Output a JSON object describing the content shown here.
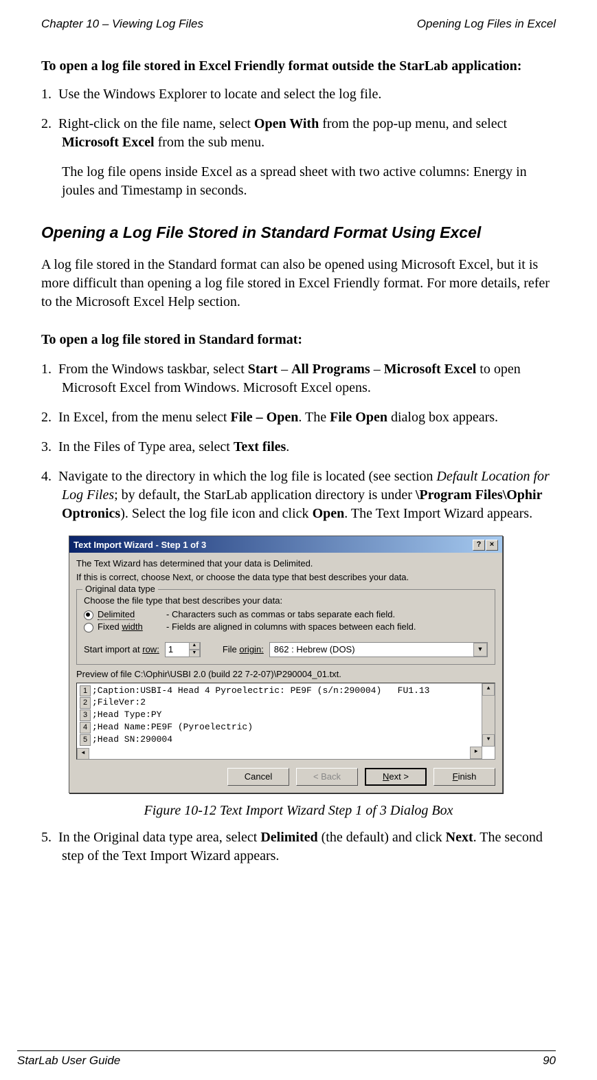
{
  "header": {
    "left": "Chapter 10 – Viewing Log Files",
    "right": "Opening Log Files in Excel"
  },
  "intro_bold": "To open a log file stored in Excel Friendly format outside the StarLab application:",
  "list1": {
    "i1_num": "1.",
    "i1_text": "Use the Windows Explorer to locate and select the log file.",
    "i2_num": "2.",
    "i2_a": "Right-click on the file name, select ",
    "i2_b": "Open With",
    "i2_c": " from the pop-up menu, and select ",
    "i2_d": "Microsoft Excel",
    "i2_e": " from the sub menu.",
    "i2_cont": "The log file opens inside Excel as a spread sheet with two active columns: Energy in joules and Timestamp in seconds."
  },
  "section_heading": "Opening a Log File Stored in Standard Format Using Excel",
  "section_para": "A log file stored in the Standard format can also be opened using Microsoft Excel, but it is more difficult than opening a log file stored in Excel Friendly format. For more details, refer to the Microsoft Excel Help section.",
  "sub_bold": "To open a log file stored in Standard format:",
  "list2": {
    "i1_num": "1.",
    "i1_a": "From the Windows taskbar, select ",
    "i1_b": "Start",
    "i1_c": " – ",
    "i1_d": "All Programs",
    "i1_e": " – ",
    "i1_f": "Microsoft Excel",
    "i1_g": " to open Microsoft Excel from Windows. Microsoft Excel opens.",
    "i2_num": "2.",
    "i2_a": "In Excel, from the menu select ",
    "i2_b": "File – Open",
    "i2_c": ". The ",
    "i2_d": "File Open",
    "i2_e": " dialog box appears.",
    "i3_num": "3.",
    "i3_a": "In the Files of Type area, select ",
    "i3_b": "Text files",
    "i3_c": ".",
    "i4_num": "4.",
    "i4_a": "Navigate to the directory in which the log file is located (see section ",
    "i4_b": "Default Location for Log Files",
    "i4_c": "; by default, the StarLab application directory is under ",
    "i4_d": "\\Program Files\\Ophir Optronics",
    "i4_e": "). Select the log file icon and click ",
    "i4_f": "Open",
    "i4_g": ". The Text Import Wizard appears."
  },
  "wizard": {
    "title": "Text Import Wizard - Step 1 of 3",
    "line1": "The Text Wizard has determined that your data is Delimited.",
    "line2": "If this is correct, choose Next, or choose the data type that best describes your data.",
    "group_title": "Original data type",
    "group_desc": "Choose the file type that best describes your data:",
    "opt1_label": "Delimited",
    "opt1_desc": "- Characters such as commas or tabs separate each field.",
    "opt2_label_a": "Fixed ",
    "opt2_label_b": "width",
    "opt2_desc": "- Fields are aligned in columns with spaces between each field.",
    "start_label_a": "Start import at ",
    "start_label_b": "row:",
    "start_value": "1",
    "origin_label_a": "File ",
    "origin_label_b": "origin:",
    "origin_value": "862 : Hebrew (DOS)",
    "preview_label": "Preview of file C:\\Ophir\\USBI 2.0 (build 22 7-2-07)\\P290004_01.txt.",
    "preview_lines": {
      "l1n": "1",
      "l1": ";Caption:USBI-4 Head 4 Pyroelectric: PE9F (s/n:290004)   FU1.13",
      "l2n": "2",
      "l2": ";FileVer:2",
      "l3n": "3",
      "l3": ";Head Type:PY",
      "l4n": "4",
      "l4": ";Head Name:PE9F (Pyroelectric)",
      "l5n": "5",
      "l5": ";Head SN:290004"
    },
    "btn_cancel": "Cancel",
    "btn_back": "< Back",
    "btn_next": "Next >",
    "btn_finish": "Finish"
  },
  "figcaption": "Figure 10-12 Text Import Wizard Step 1 of 3 Dialog Box",
  "list3": {
    "i5_num": "5.",
    "i5_a": "In the Original data type area, select ",
    "i5_b": "Delimited",
    "i5_c": " (the default) and click ",
    "i5_d": "Next",
    "i5_e": ". The second step of the Text Import Wizard appears."
  },
  "footer": {
    "left": "StarLab User Guide",
    "right": "90"
  }
}
